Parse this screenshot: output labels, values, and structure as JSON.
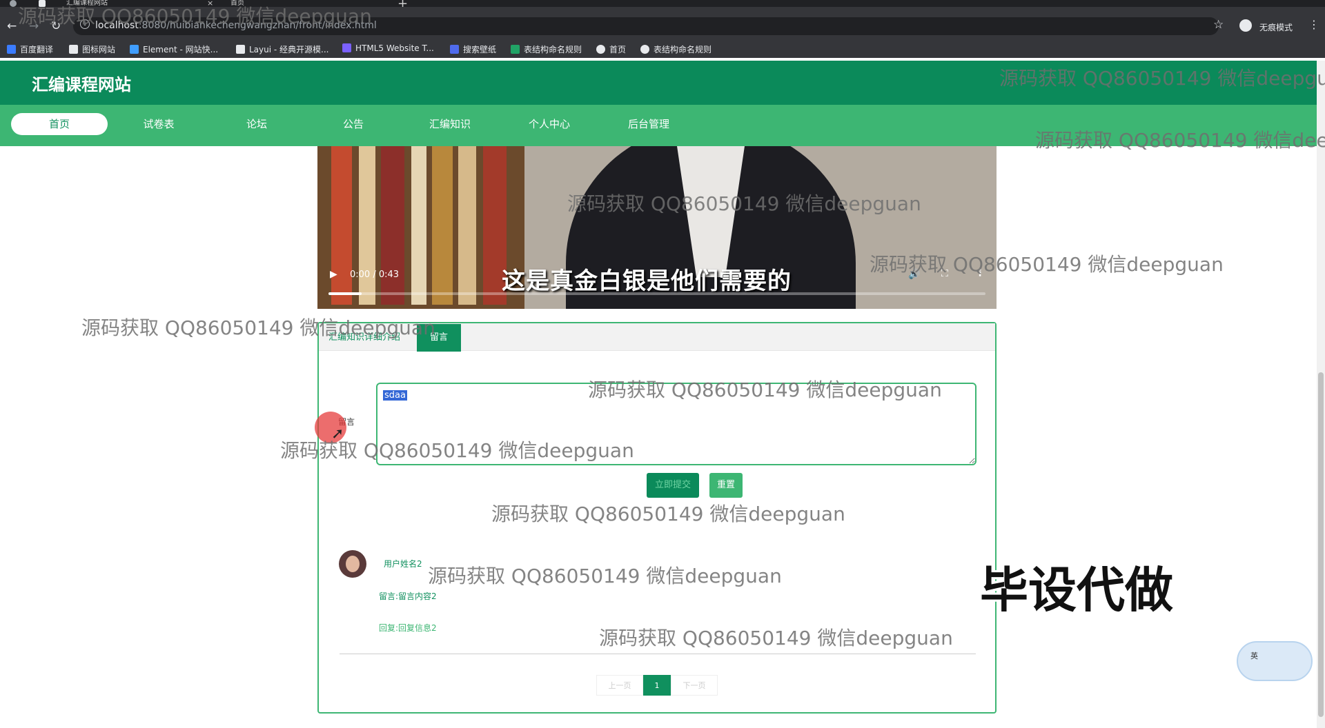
{
  "browser": {
    "tabs": [
      {
        "title": "汇编课程网站"
      },
      {
        "title": "首页"
      }
    ],
    "url_host": "localhost",
    "url_path": ":8080/huibiankechengwangzhan/front/index.html",
    "incognito_label": "无痕模式",
    "bookmarks": [
      {
        "label": "百度翻译",
        "color": "#3b7cff"
      },
      {
        "label": "图标网站",
        "color": "#e8eaed"
      },
      {
        "label": "Element - 网站快...",
        "color": "#409eff"
      },
      {
        "label": "Layui - 经典开源模...",
        "color": "#e8eaed"
      },
      {
        "label": "HTML5 Website T...",
        "color": "#7b61ff"
      },
      {
        "label": "搜索壁纸",
        "color": "#4f6bed"
      },
      {
        "label": "表结构命名规则",
        "color": "#21a366"
      },
      {
        "label": "首页",
        "color": "#e8eaed"
      },
      {
        "label": "表结构命名规则",
        "color": "#e8eaed"
      }
    ]
  },
  "site": {
    "title": "汇编课程网站",
    "accent": "#0b8a5a",
    "nav": [
      {
        "label": "首页",
        "active": true
      },
      {
        "label": "试卷表"
      },
      {
        "label": "论坛"
      },
      {
        "label": "公告"
      },
      {
        "label": "汇编知识"
      },
      {
        "label": "个人中心"
      },
      {
        "label": "后台管理"
      }
    ]
  },
  "video": {
    "subtitle": "这是真金白银是他们需要的",
    "time": "0:00 / 0:43",
    "progress": 0.05
  },
  "detail": {
    "tabs": [
      "汇编知识详细介绍",
      "留言"
    ],
    "active_tab": 1,
    "form": {
      "label": "留言",
      "value": "sdaa",
      "submit_label": "立即提交",
      "reset_label": "重置"
    },
    "comments": [
      {
        "user": "用户姓名2",
        "message": "留言:留言内容2",
        "reply": "回复:回复信息2"
      }
    ],
    "pagination": {
      "prev": "上一页",
      "current": "1",
      "next": "下一页"
    }
  },
  "overlays": {
    "watermark": "源码获取 QQ86050149 微信deepguan",
    "stamp": "毕设代做",
    "widget_label": "英"
  }
}
